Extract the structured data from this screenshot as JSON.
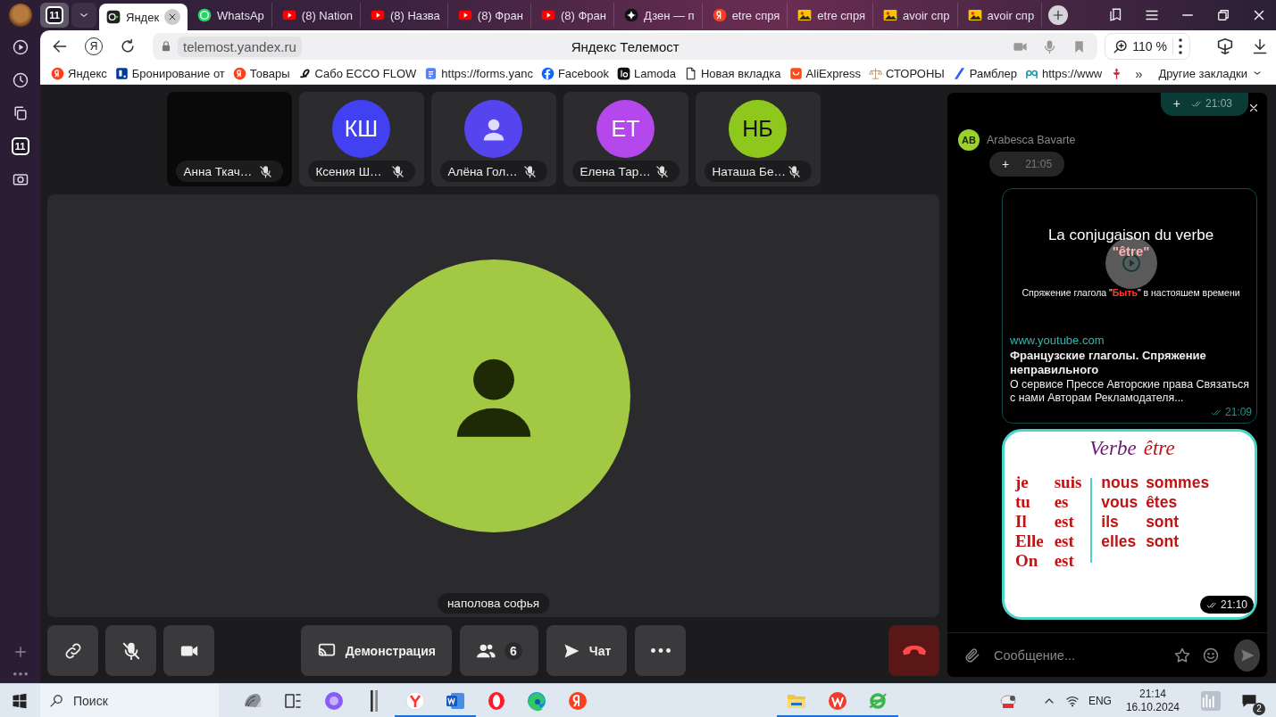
{
  "side_panel": {
    "tab_count": "11"
  },
  "tab_strip": {
    "group_count": "11",
    "tabs": [
      {
        "title": "Яндек",
        "kind": "telemost",
        "selected": true
      },
      {
        "title": "WhatsAp",
        "kind": "whatsapp",
        "selected": false
      },
      {
        "title": "(8) Nation",
        "kind": "youtube",
        "selected": false
      },
      {
        "title": "(8) Назва",
        "kind": "youtube",
        "selected": false
      },
      {
        "title": "(8) Фран",
        "kind": "youtube",
        "selected": false
      },
      {
        "title": "(8) Фран",
        "kind": "youtube",
        "selected": false
      },
      {
        "title": "Дзен — п",
        "kind": "dzen",
        "selected": false
      },
      {
        "title": "etre спря",
        "kind": "yandex",
        "selected": false
      },
      {
        "title": "etre спря",
        "kind": "image",
        "selected": false
      },
      {
        "title": "avoir спр",
        "kind": "image",
        "selected": false
      },
      {
        "title": "avoir спр",
        "kind": "image",
        "selected": false
      }
    ]
  },
  "address_bar": {
    "home": "Я",
    "url": "telemost.yandex.ru",
    "page_title": "Яндекс Телемост",
    "zoom": "110 %"
  },
  "bookmarks": {
    "items": [
      {
        "title": "Яндекс",
        "kind": "yandex"
      },
      {
        "title": "Бронирование от",
        "kind": "booking"
      },
      {
        "title": "Товары",
        "kind": "yandex"
      },
      {
        "title": "Сабо ECCO FLOW",
        "kind": "ecco"
      },
      {
        "title": "https://forms.yanc",
        "kind": "forms"
      },
      {
        "title": "Facebook",
        "kind": "facebook"
      },
      {
        "title": "Lamoda",
        "kind": "lamoda"
      },
      {
        "title": "Новая вкладка",
        "kind": "page"
      },
      {
        "title": "AliExpress",
        "kind": "ali"
      },
      {
        "title": "СТОРОНЫ",
        "kind": "scales"
      },
      {
        "title": "Рамблер",
        "kind": "rambler"
      },
      {
        "title": "https://www",
        "kind": "pq"
      },
      {
        "kind": "figure"
      }
    ],
    "more": "»",
    "other": "Другие закладки"
  },
  "participants": [
    {
      "name": "Анна Ткач…",
      "kind": "video",
      "muted": true
    },
    {
      "name": "Ксения Ш…",
      "kind": "initials",
      "initials": "КШ",
      "color": "#4141f2",
      "muted": true
    },
    {
      "name": "Алёна Гол…",
      "kind": "silhouette",
      "color": "#5545ee",
      "muted": true
    },
    {
      "name": "Елена Тар…",
      "kind": "initials",
      "initials": "ЕТ",
      "color": "#b548ec",
      "muted": true
    },
    {
      "name": "Наташа Бе…",
      "kind": "initials",
      "initials": "НБ",
      "color": "#8fc81c",
      "muted": true
    }
  ],
  "stage": {
    "name": "наполова софья"
  },
  "controls": [
    {
      "kind": "link"
    },
    {
      "kind": "mic_off"
    },
    {
      "kind": "camera"
    },
    {
      "kind": "screen",
      "label": "Демонстрация"
    },
    {
      "kind": "people",
      "count": "6"
    },
    {
      "kind": "chat",
      "label": "Чат"
    },
    {
      "kind": "more"
    },
    {
      "kind": "hangup"
    }
  ],
  "chat": {
    "messages": [
      {
        "kind": "outgoing",
        "text": "+",
        "time": "21:03"
      },
      {
        "kind": "incoming",
        "initials": "AB",
        "sender": "Arabesca Bavarte",
        "text": "+",
        "time": "21:05"
      },
      {
        "kind": "link_preview",
        "preview_title": "La conjugaison du verbe",
        "preview_highlight": "\"être\"",
        "preview_caption": "Спряжение глагола \"**Быть**\" в настояшем времени",
        "site": "www.youtube.com",
        "title": "Французские глаголы. Спряжение неправильного",
        "description": "О сервисе Прессе Авторские права Связаться с нами Авторам Рекламодателя...",
        "time": "21:09"
      },
      {
        "kind": "image",
        "heading": "Verbe",
        "heading_highlight": "être",
        "left_rows": [
          [
            "je",
            "suis"
          ],
          [
            "tu",
            "es"
          ],
          [
            "Il",
            "est"
          ],
          [
            "Elle",
            "est"
          ],
          [
            "On",
            "est"
          ]
        ],
        "right_rows": [
          [
            "nous",
            "sommes"
          ],
          [
            "vous",
            "êtes"
          ],
          [
            "ils",
            "sont"
          ],
          [
            "elles",
            "sont"
          ]
        ],
        "time": "21:10"
      }
    ],
    "composer": {
      "placeholder": "Сообщение..."
    }
  },
  "taskbar": {
    "search_placeholder": "Поиск",
    "app_groups": [
      [
        {
          "kind": "shell",
          "running": false
        },
        {
          "kind": "taskview",
          "running": false
        },
        {
          "kind": "alice",
          "running": false
        },
        {
          "kind": "notes",
          "running": false
        },
        {
          "kind": "ybrowser",
          "running": true
        },
        {
          "kind": "word",
          "running": true
        },
        {
          "kind": "opera",
          "running": false
        },
        {
          "kind": "edge",
          "running": false
        },
        {
          "kind": "yandex",
          "running": false
        }
      ],
      [
        {
          "kind": "explorer",
          "running": true
        },
        {
          "kind": "wps",
          "running": true
        },
        {
          "kind": "ie",
          "running": true
        }
      ],
      [
        {
          "kind": "pdf",
          "running": false
        }
      ]
    ],
    "language": "ENG",
    "time": "21:14",
    "date": "16.10.2024",
    "notifications": "2"
  }
}
